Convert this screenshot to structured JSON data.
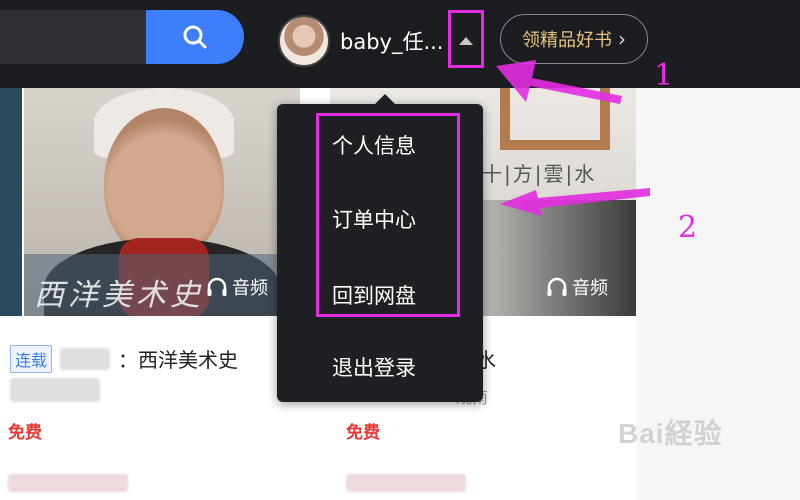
{
  "header": {
    "username": "baby_任...",
    "promo_label": "领精品好书",
    "promo_chevron": "›"
  },
  "dropdown": {
    "items": [
      {
        "label": "个人信息"
      },
      {
        "label": "订单中心"
      },
      {
        "label": "回到网盘"
      },
      {
        "label": "退出登录"
      }
    ]
  },
  "cards": [
    {
      "cover_text": "西洋美术史",
      "audio_label": "音频",
      "tag": "连载",
      "title": "：西洋美术史",
      "price": "免费"
    },
    {
      "brand_text": "十|方|雲|水",
      "audio_label": "音频",
      "title": "风水",
      "author": "观南",
      "price": "免费"
    }
  ],
  "annotations": {
    "label_1": "1",
    "label_2": "2",
    "highlight_color": "#e22ce0"
  },
  "watermark": {
    "text": "Bai経验"
  },
  "icons": {
    "search": "search-icon",
    "caret": "caret-up-icon",
    "headphones": "headphones-icon"
  },
  "colors": {
    "topbar": "#1c1d21",
    "search_button": "#3d7ffb",
    "promo_text": "#e4c47e",
    "free_red": "#e53935",
    "serial_blue": "#3f7ee8"
  }
}
